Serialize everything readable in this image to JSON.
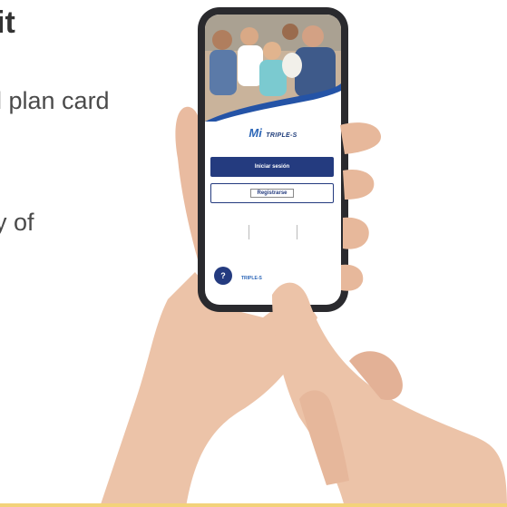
{
  "background_text": {
    "heading": "it",
    "line1": "l plan card",
    "line2": "y of"
  },
  "app": {
    "logo_mi": "Mi",
    "logo_brand": "TRIPLE-S",
    "login_button": "Iniciar sesión",
    "register_button": "Registrarse",
    "help_button": "?",
    "footer_brand": "TRIPLE-S"
  },
  "colors": {
    "primary_navy": "#243b7f",
    "brand_blue": "#2d67b8",
    "accent_strip": "#f3d27a"
  }
}
